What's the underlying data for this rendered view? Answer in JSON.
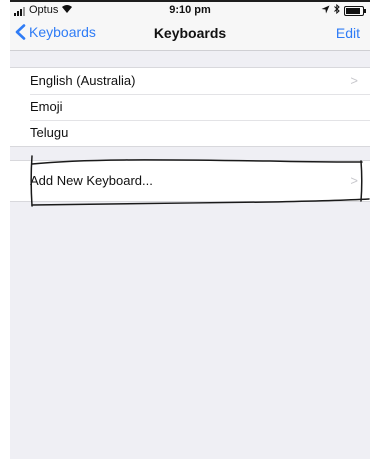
{
  "status_bar": {
    "carrier": "Optus",
    "time": "9:10 pm"
  },
  "nav": {
    "back_label": "Keyboards",
    "title": "Keyboards",
    "edit_label": "Edit"
  },
  "keyboards": [
    {
      "label": "English (Australia)"
    },
    {
      "label": "Emoji"
    },
    {
      "label": "Telugu"
    }
  ],
  "add_keyboard": {
    "label": "Add New Keyboard..."
  },
  "colors": {
    "accent": "#2f7cf6",
    "background": "#efeff4",
    "annotation": "#1a1a1a"
  },
  "icons": {
    "back": "chevron-left-icon",
    "disclosure": "chevron-right-icon",
    "wifi": "wifi-icon",
    "battery": "battery-icon"
  }
}
